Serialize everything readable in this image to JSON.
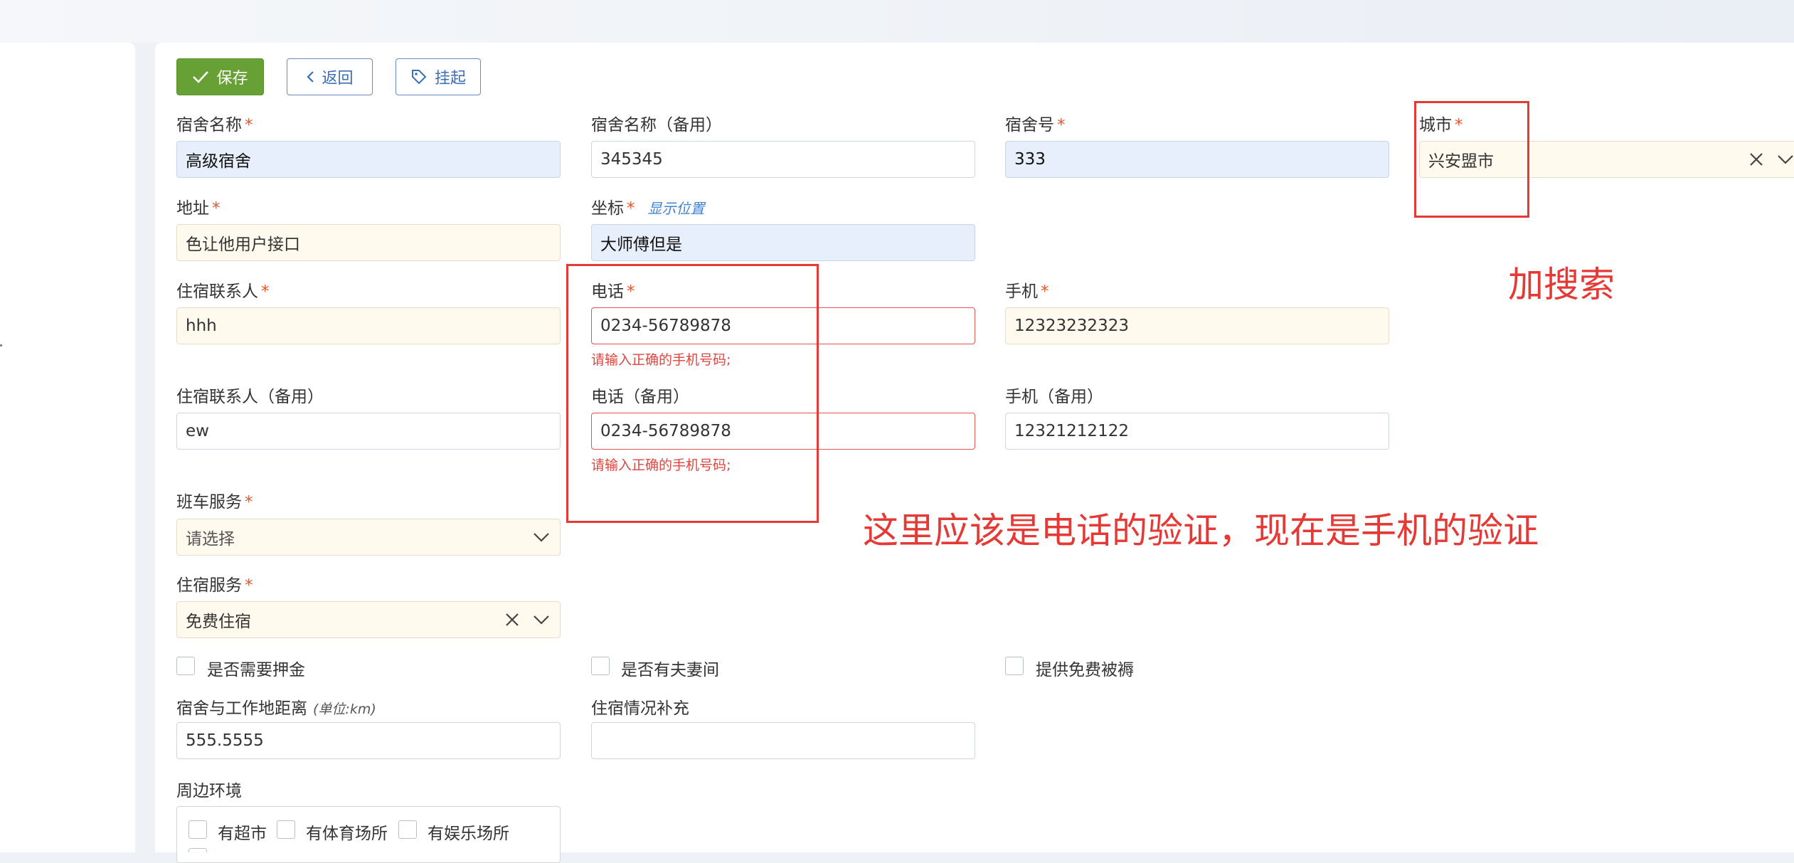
{
  "toolbar": {
    "save": "保存",
    "back": "返回",
    "hang": "挂起"
  },
  "fields": {
    "dorm_name": {
      "label": "宿舍名称",
      "req": "*",
      "value": "高级宿舍"
    },
    "dorm_name_alt": {
      "label": "宿舍名称（备用）",
      "value": "345345"
    },
    "dorm_no": {
      "label": "宿舍号",
      "req": "*",
      "value": "333"
    },
    "city": {
      "label": "城市",
      "req": "*",
      "value": "兴安盟市"
    },
    "address": {
      "label": "地址",
      "req": "*",
      "value": "色让他用户接口"
    },
    "coords": {
      "label": "坐标",
      "req": "*",
      "link": "显示位置",
      "value": "大师傅但是"
    },
    "contact": {
      "label": "住宿联系人",
      "req": "*",
      "value": "hhh"
    },
    "phone": {
      "label": "电话",
      "req": "*",
      "value": "0234-56789878",
      "error": "请输入正确的手机号码;"
    },
    "mobile": {
      "label": "手机",
      "req": "*",
      "value": "12323232323"
    },
    "contact_alt": {
      "label": "住宿联系人（备用）",
      "value": "ew"
    },
    "phone_alt": {
      "label": "电话（备用）",
      "value": "0234-56789878",
      "error": "请输入正确的手机号码;"
    },
    "mobile_alt": {
      "label": "手机（备用）",
      "value": "12321212122"
    },
    "shuttle": {
      "label": "班车服务",
      "req": "*",
      "placeholder": "请选择"
    },
    "lodging": {
      "label": "住宿服务",
      "req": "*",
      "value": "免费住宿"
    },
    "distance": {
      "label": "宿舍与工作地距离",
      "hint": "(单位:km)",
      "value": "555.5555"
    },
    "extra": {
      "label": "住宿情况补充",
      "value": ""
    },
    "env": {
      "label": "周边环境"
    }
  },
  "checkboxes": {
    "deposit": "是否需要押金",
    "couple_room": "是否有夫妻间",
    "free_bedding": "提供免费被褥",
    "supermarket": "有超市",
    "gym": "有体育场所",
    "entertainment": "有娱乐场所"
  },
  "annotations": {
    "search": "加搜索",
    "validation": "这里应该是电话的验证，现在是手机的验证"
  },
  "colors": {
    "save_green": "#67a034",
    "annot_red": "#e53935",
    "required": "#e4572e"
  }
}
